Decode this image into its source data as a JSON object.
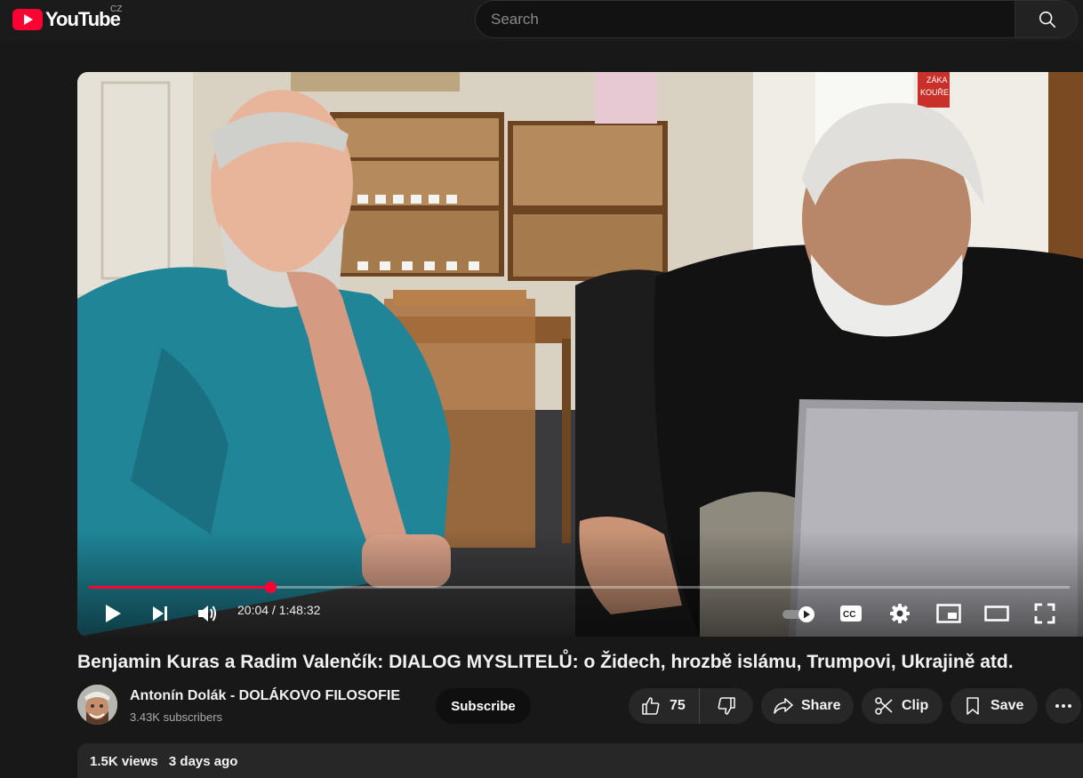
{
  "header": {
    "logo_text": "YouTube",
    "country_code": "CZ",
    "search_placeholder": "Search",
    "search_icon": "search-icon"
  },
  "player": {
    "current_time": "20:04",
    "duration": "1:48:32",
    "time_display": "20:04 / 1:48:32",
    "progress_fraction": 0.1848,
    "scene_sign_text": [
      "ZÁKA",
      "KOUŘE"
    ],
    "accent_color": "#ff0033",
    "icons": [
      "play-icon",
      "next-icon",
      "volume-icon",
      "autoplay-toggle-icon",
      "captions-icon",
      "settings-icon",
      "miniplayer-icon",
      "theater-mode-icon",
      "fullscreen-icon"
    ]
  },
  "video": {
    "title": "Benjamin Kuras a Radim Valenčík: DIALOG MYSLITELŮ: o Židech, hrozbě islámu, Trumpovi, Ukrajině atd.",
    "views": "1.5K views",
    "uploaded": "3 days ago"
  },
  "channel": {
    "name": "Antonín Dolák - DOLÁKOVO FILOSOFIE",
    "subscribers": "3.43K subscribers",
    "subscribe_label": "Subscribe"
  },
  "actions": {
    "likes": "75",
    "share_label": "Share",
    "clip_label": "Clip",
    "save_label": "Save"
  }
}
